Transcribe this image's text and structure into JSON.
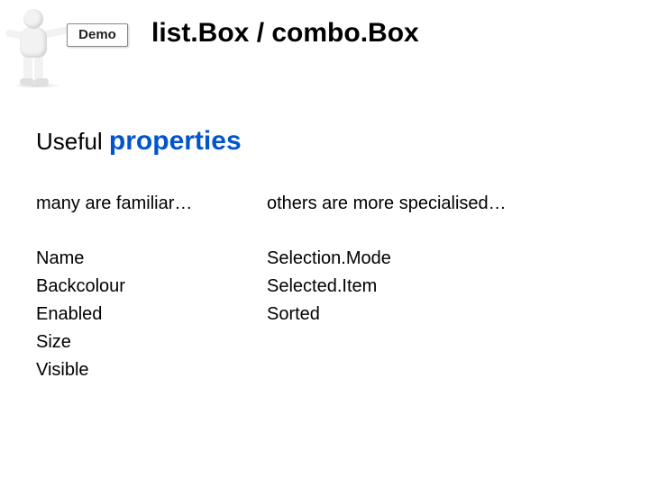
{
  "badge": {
    "sign_text": "Demo"
  },
  "title": "list.Box / combo.Box",
  "subtitle": {
    "plain": "Useful ",
    "emph": "properties"
  },
  "columns": {
    "left": {
      "heading": "many are familiar…",
      "items": [
        "Name",
        "Backcolour",
        "Enabled",
        "Size",
        "Visible"
      ]
    },
    "right": {
      "heading": "others are more specialised…",
      "items": [
        "Selection.Mode",
        "Selected.Item",
        "Sorted"
      ]
    }
  }
}
